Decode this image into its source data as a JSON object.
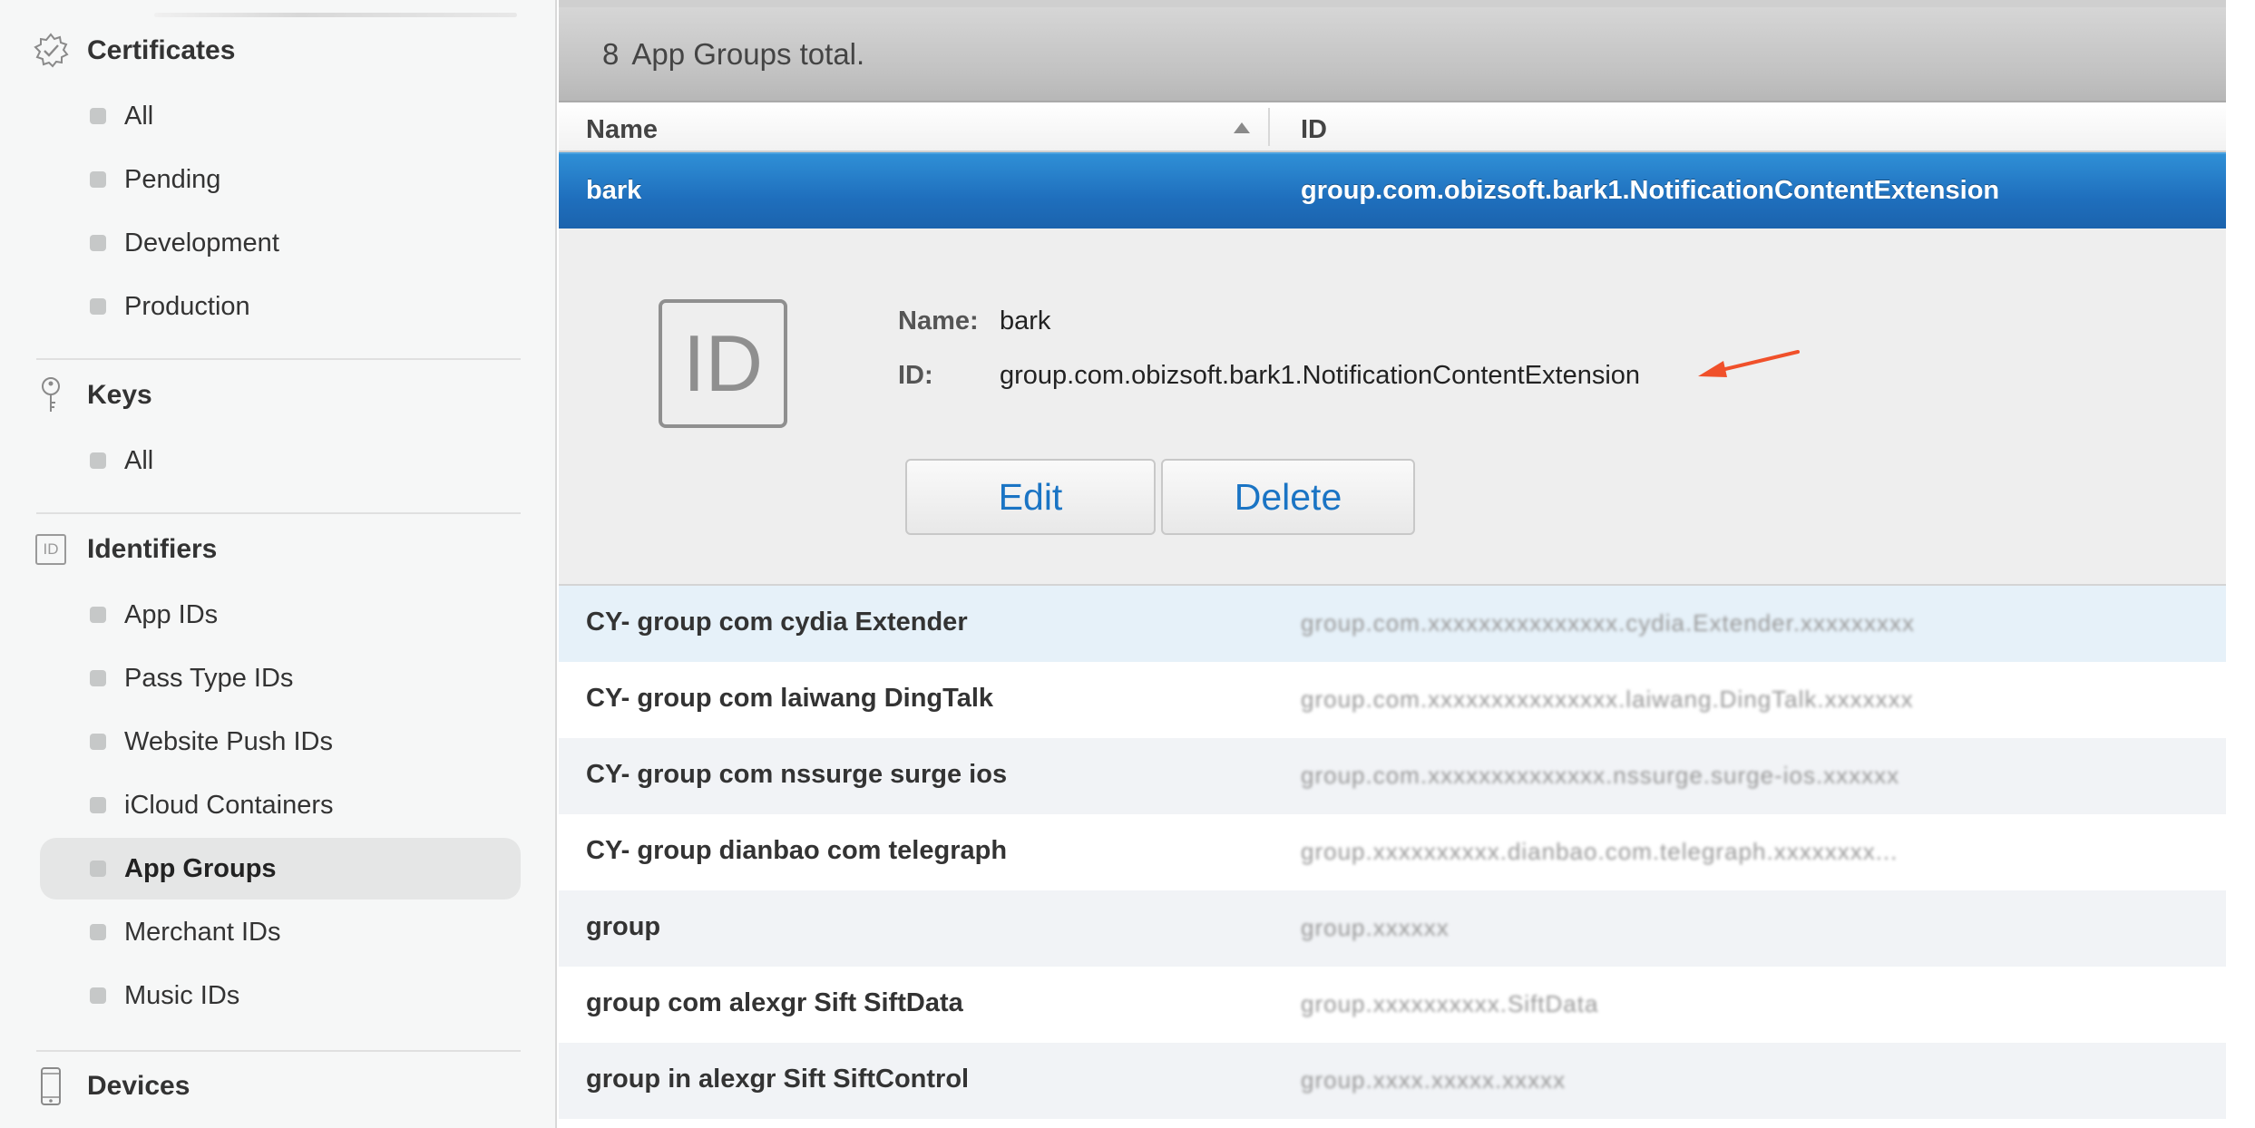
{
  "sidebar": {
    "sections": [
      {
        "label": "Certificates",
        "icon": "certificate-badge-icon",
        "items": [
          "All",
          "Pending",
          "Development",
          "Production"
        ]
      },
      {
        "label": "Keys",
        "icon": "key-icon",
        "items": [
          "All"
        ]
      },
      {
        "label": "Identifiers",
        "icon": "id-icon",
        "icon_text": "ID",
        "items": [
          "App IDs",
          "Pass Type IDs",
          "Website Push IDs",
          "iCloud Containers",
          "App Groups",
          "Merchant IDs",
          "Music IDs"
        ],
        "selected": "App Groups"
      },
      {
        "label": "Devices",
        "icon": "device-phone-icon",
        "items": []
      }
    ]
  },
  "summary": {
    "count": "8",
    "text": "App Groups total."
  },
  "table": {
    "columns": {
      "name": "Name",
      "id": "ID"
    },
    "sort_column": "Name",
    "selected_row": {
      "name": "bark",
      "id": "group.com.obizsoft.bark1.NotificationContentExtension"
    },
    "rows": [
      {
        "name": "CY- group com cydia Extender",
        "id": "group.com.xxxxxxxxxxxxxxx.cydia.Extender.xxxxxxxxx"
      },
      {
        "name": "CY- group com laiwang DingTalk",
        "id": "group.com.xxxxxxxxxxxxxxx.laiwang.DingTalk.xxxxxxx"
      },
      {
        "name": "CY- group com nssurge surge ios",
        "id": "group.com.xxxxxxxxxxxxxx.nssurge.surge-ios.xxxxxx"
      },
      {
        "name": "CY- group dianbao com telegraph",
        "id": "group.xxxxxxxxxx.dianbao.com.telegraph.xxxxxxxx..."
      },
      {
        "name": "group",
        "id": "group.xxxxxx"
      },
      {
        "name": "group com alexgr Sift SiftData",
        "id": "group.xxxxxxxxxx.SiftData"
      },
      {
        "name": "group in alexgr Sift SiftControl",
        "id": "group.xxxx.xxxxx.xxxxx"
      }
    ]
  },
  "detail": {
    "badge_text": "ID",
    "name_label": "Name:",
    "name_value": "bark",
    "id_label": "ID:",
    "id_value": "group.com.obizsoft.bark1.NotificationContentExtension",
    "edit_label": "Edit",
    "delete_label": "Delete"
  },
  "colors": {
    "selection_blue": "#1f6fbd",
    "link_blue": "#1a74c4",
    "annotation_arrow": "#f0502a"
  }
}
